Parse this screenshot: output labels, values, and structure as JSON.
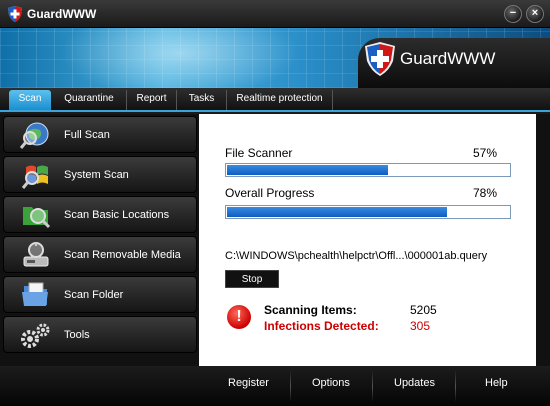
{
  "window": {
    "title": "GuardWWW"
  },
  "banner": {
    "logo_text": "GuardWWW"
  },
  "tabs": [
    {
      "label": "Scan",
      "active": true
    },
    {
      "label": "Quarantine",
      "active": false
    },
    {
      "label": "Report",
      "active": false
    },
    {
      "label": "Tasks",
      "active": false
    },
    {
      "label": "Realtime protection",
      "active": false
    }
  ],
  "sidebar": {
    "items": [
      {
        "label": "Full Scan",
        "icon": "globe-magnifier-icon"
      },
      {
        "label": "System Scan",
        "icon": "windows-flag-magnifier-icon"
      },
      {
        "label": "Scan Basic Locations",
        "icon": "folder-magnifier-icon"
      },
      {
        "label": "Scan Removable Media",
        "icon": "usb-drive-icon"
      },
      {
        "label": "Scan Folder",
        "icon": "folder-icon"
      },
      {
        "label": "Tools",
        "icon": "gears-icon"
      }
    ]
  },
  "scanner": {
    "file_label": "File Scanner",
    "file_percent": "57%",
    "file_progress": 57,
    "overall_label": "Overall Progress",
    "overall_percent": "78%",
    "overall_progress": 78,
    "current_path": "C:\\WINDOWS\\pchealth\\helpctr\\Offl...\\000001ab.query",
    "stop_label": "Stop",
    "alert_glyph": "!",
    "scanning_label": "Scanning Items:",
    "scanning_count": "5205",
    "infections_label": "Infections Detected:",
    "infections_count": "305"
  },
  "bottom": {
    "register": "Register",
    "options": "Options",
    "updates": "Updates",
    "help": "Help"
  },
  "colors": {
    "accent": "#3aa3da",
    "infection": "#cc0000",
    "progress": "#1464c8"
  }
}
